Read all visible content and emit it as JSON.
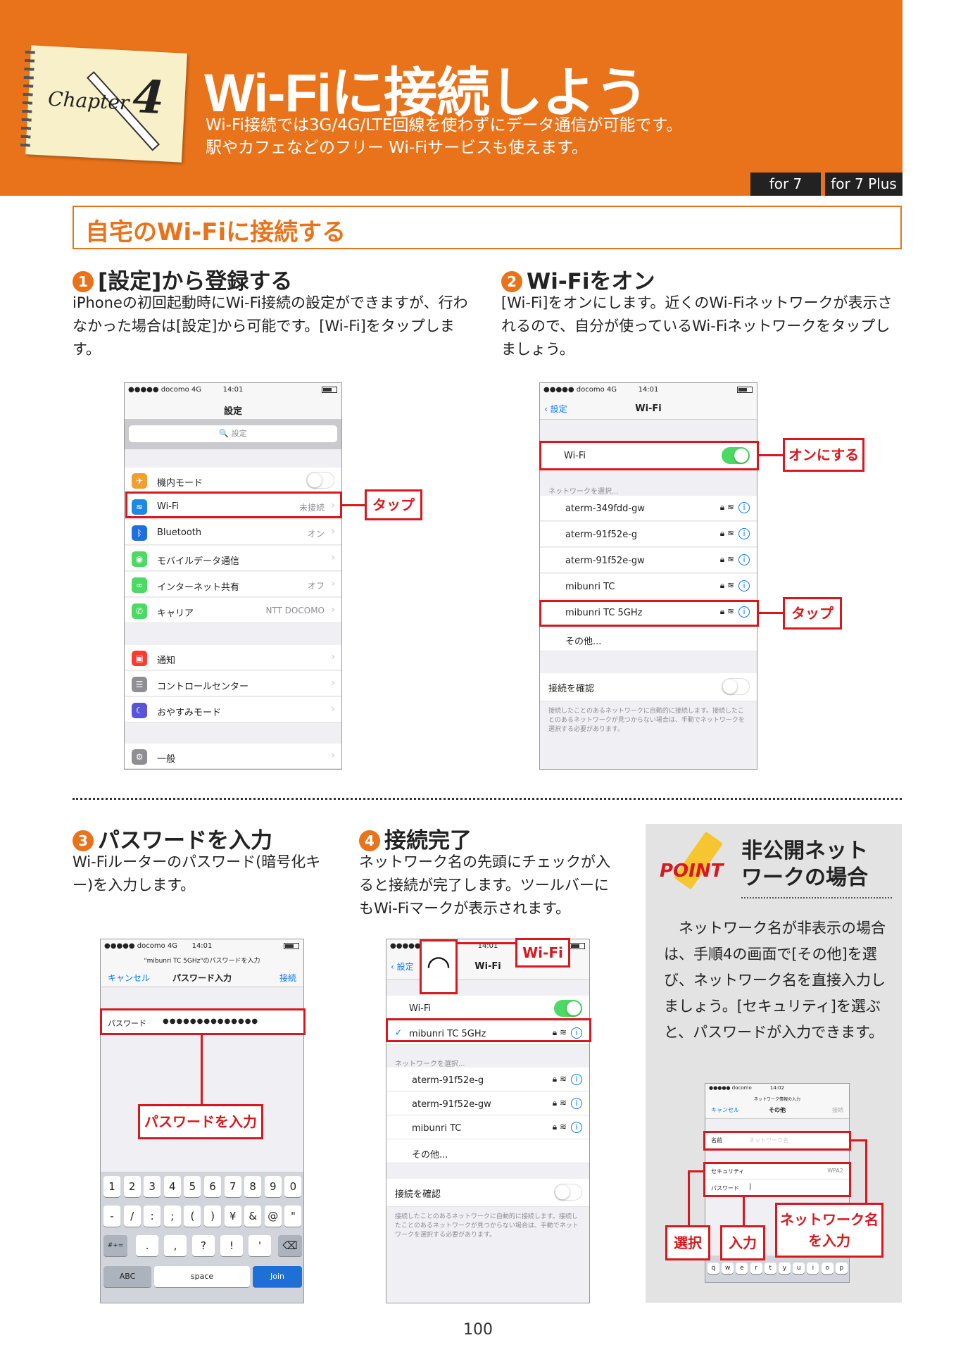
{
  "header": {
    "chapter_word": "Chapter",
    "chapter_number": "4",
    "title": "Wi-Fiに接続しよう",
    "subtitle_line1": "Wi-Fi接続では3G/4G/LTE回線を使わずにデータ通信が可能です。",
    "subtitle_line2": "駅やカフェなどのフリー Wi-Fiサービスも使えます。",
    "badge_for7": "for 7",
    "badge_for7plus": "for 7 Plus"
  },
  "section": {
    "title": "自宅のWi-Fiに接続する"
  },
  "steps": [
    {
      "num": "1",
      "title": "[設定]から登録する",
      "text": "iPhoneの初回起動時にWi-Fi接続の設定ができますが、行わなかった場合は[設定]から可能です。[Wi-Fi]をタップします。"
    },
    {
      "num": "2",
      "title": "Wi-Fiをオン",
      "text": "[Wi-Fi]をオンにします。近くのWi-Fiネットワークが表示されるので、自分が使っているWi-Fiネットワークをタップしましょう。"
    },
    {
      "num": "3",
      "title": "パスワードを入力",
      "text": "Wi-Fiルーターのパスワード(暗号化キー)を入力します。"
    },
    {
      "num": "4",
      "title": "接続完了",
      "text": "ネットワーク名の先頭にチェックが入ると接続が完了します。ツールバーにもWi-Fiマークが表示されます。"
    }
  ],
  "screen1": {
    "carrier": "●●●●● docomo  4G",
    "time": "14:01",
    "nav_title": "設定",
    "search_placeholder": "🔍 設定",
    "rows": [
      {
        "label": "機内モード",
        "value": ""
      },
      {
        "label": "Wi-Fi",
        "value": "未接続"
      },
      {
        "label": "Bluetooth",
        "value": "オン"
      },
      {
        "label": "モバイルデータ通信",
        "value": ""
      },
      {
        "label": "インターネット共有",
        "value": "オフ"
      },
      {
        "label": "キャリア",
        "value": "NTT DOCOMO"
      },
      {
        "label": "通知",
        "value": ""
      },
      {
        "label": "コントロールセンター",
        "value": ""
      },
      {
        "label": "おやすみモード",
        "value": ""
      },
      {
        "label": "一般",
        "value": ""
      }
    ],
    "callout": "タップ"
  },
  "screen2": {
    "carrier": "●●●●● docomo  4G",
    "time": "14:01",
    "back_label": "設定",
    "nav_title": "Wi-Fi",
    "wifi_label": "Wi-Fi",
    "choose_label": "ネットワークを選択...",
    "networks": [
      "aterm-349fdd-gw",
      "aterm-91f52e-g",
      "aterm-91f52e-gw",
      "mibunri TC",
      "mibunri TC 5GHz"
    ],
    "other_label": "その他...",
    "ask_label": "接続を確認",
    "footnote": "接続したことのあるネットワークに自動的に接続します。接続したことのあるネットワークが見つからない場合は、手動でネットワークを選択する必要があります。",
    "callout_on": "オンにする",
    "callout_tap": "タップ"
  },
  "screen3": {
    "carrier": "●●●●● docomo  4G",
    "time": "14:01",
    "prompt": "\"mibunri TC 5GHz\"のパスワードを入力",
    "cancel": "キャンセル",
    "nav_title": "パスワード入力",
    "join": "接続",
    "password_label": "パスワード",
    "password_value": "●●●●●●●●●●●●●●",
    "callout": "パスワードを入力",
    "keys_row1": [
      "1",
      "2",
      "3",
      "4",
      "5",
      "6",
      "7",
      "8",
      "9",
      "0"
    ],
    "keys_row2": [
      "-",
      "/",
      ":",
      ";",
      "(",
      ")",
      "¥",
      "&",
      "@",
      "\""
    ],
    "keys_row3": [
      ".",
      ",",
      "?",
      "!",
      "'"
    ],
    "key_shift": "#+=",
    "key_abc": "ABC",
    "key_space": "space",
    "key_join": "Join"
  },
  "screen4": {
    "carrier": "●●●●● docomo",
    "time": "14:01",
    "back_label": "設定",
    "nav_title": "Wi-Fi",
    "wifi_label": "Wi-Fi",
    "connected": "mibunri TC 5GHz",
    "choose_label": "ネットワークを選択...",
    "networks": [
      "aterm-91f52e-g",
      "aterm-91f52e-gw",
      "mibunri TC"
    ],
    "other_label": "その他...",
    "ask_label": "接続を確認",
    "footnote": "接続したことのあるネットワークに自動的に接続します。接続したことのあるネットワークが見つからない場合は、手動でネットワークを選択する必要があります。",
    "callout": "Wi-Fi"
  },
  "point": {
    "label": "POINT",
    "title_line1": "非公開ネット",
    "title_line2": "ワークの場合",
    "text": "ネットワーク名が非表示の場合は、手順4の画面で[その他]を選び、ネットワーク名を直接入力しましょう。[セキュリティ]を選ぶと、パスワードが入力できます。",
    "screen": {
      "carrier": "●●●●● docomo",
      "time": "14:02",
      "prompt": "ネットワーク情報の入力",
      "cancel": "キャンセル",
      "nav_title": "その他",
      "join": "接続",
      "name_label": "名前",
      "name_placeholder": "ネットワーク名",
      "security_label": "セキュリティ",
      "security_value": "WPA2",
      "password_label": "パスワード",
      "keys": [
        "q",
        "w",
        "e",
        "r",
        "t",
        "y",
        "u",
        "i",
        "o",
        "p"
      ]
    },
    "callout_select": "選択",
    "callout_input": "入力",
    "callout_name": "ネットワーク名を入力"
  },
  "page_number": "100"
}
